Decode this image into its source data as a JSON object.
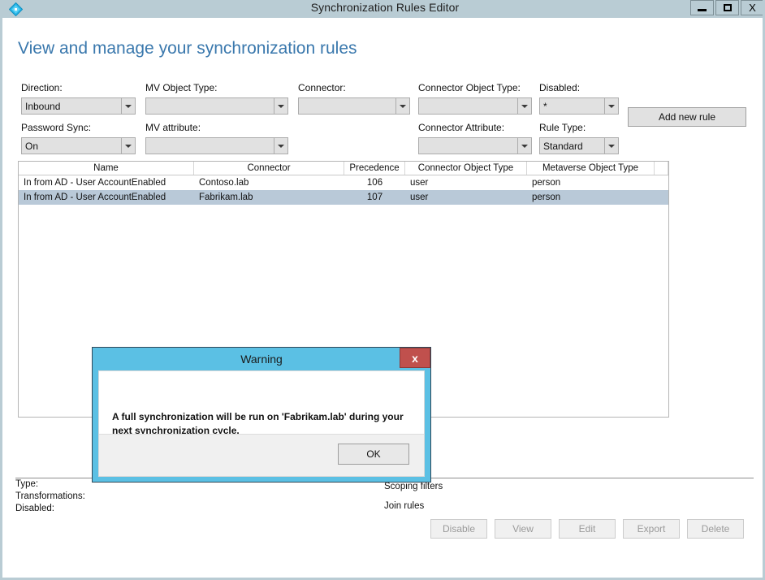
{
  "window": {
    "title": "Synchronization Rules Editor",
    "icon": "sync-diamond-icon",
    "controls": {
      "minimize": "minimize-icon",
      "maximize": "maximize-icon",
      "close": "X"
    },
    "colors": {
      "titlebar": "#b9ccd4",
      "heading": "#3a78ad",
      "selection": "#b9c9d8",
      "dialog_accent": "#5bc0e4",
      "dialog_close": "#c0504d"
    }
  },
  "heading": "View and manage your synchronization rules",
  "filters": {
    "direction": {
      "label": "Direction:",
      "value": "Inbound"
    },
    "mv_object_type": {
      "label": "MV Object Type:",
      "value": ""
    },
    "connector": {
      "label": "Connector:",
      "value": ""
    },
    "connector_object_type": {
      "label": "Connector Object Type:",
      "value": ""
    },
    "disabled": {
      "label": "Disabled:",
      "value": "*"
    },
    "password_sync": {
      "label": "Password Sync:",
      "value": "On"
    },
    "mv_attribute": {
      "label": "MV attribute:",
      "value": ""
    },
    "connector_attribute": {
      "label": "Connector Attribute:",
      "value": ""
    },
    "rule_type": {
      "label": "Rule Type:",
      "value": "Standard"
    },
    "add_new_rule": "Add new rule"
  },
  "grid": {
    "columns": [
      "Name",
      "Connector",
      "Precedence",
      "Connector Object Type",
      "Metaverse Object Type",
      ""
    ],
    "rows": [
      {
        "name": "In from AD - User AccountEnabled",
        "connector": "Contoso.lab",
        "precedence": "106",
        "connector_object_type": "user",
        "metaverse_object_type": "person",
        "selected": false
      },
      {
        "name": "In from AD - User AccountEnabled",
        "connector": "Fabrikam.lab",
        "precedence": "107",
        "connector_object_type": "user",
        "metaverse_object_type": "person",
        "selected": true
      }
    ]
  },
  "detail": {
    "type_label": "Type:",
    "transformations_label": "Transformations:",
    "disabled_label": "Disabled:",
    "scoping_filters_label": "Scoping filters",
    "join_rules_label": "Join rules"
  },
  "footer": {
    "buttons": [
      "Disable",
      "View",
      "Edit",
      "Export",
      "Delete"
    ]
  },
  "dialog": {
    "title": "Warning",
    "close_label": "x",
    "message": "A full synchronization will be run on 'Fabrikam.lab' during your next synchronization cycle.",
    "ok_label": "OK"
  }
}
